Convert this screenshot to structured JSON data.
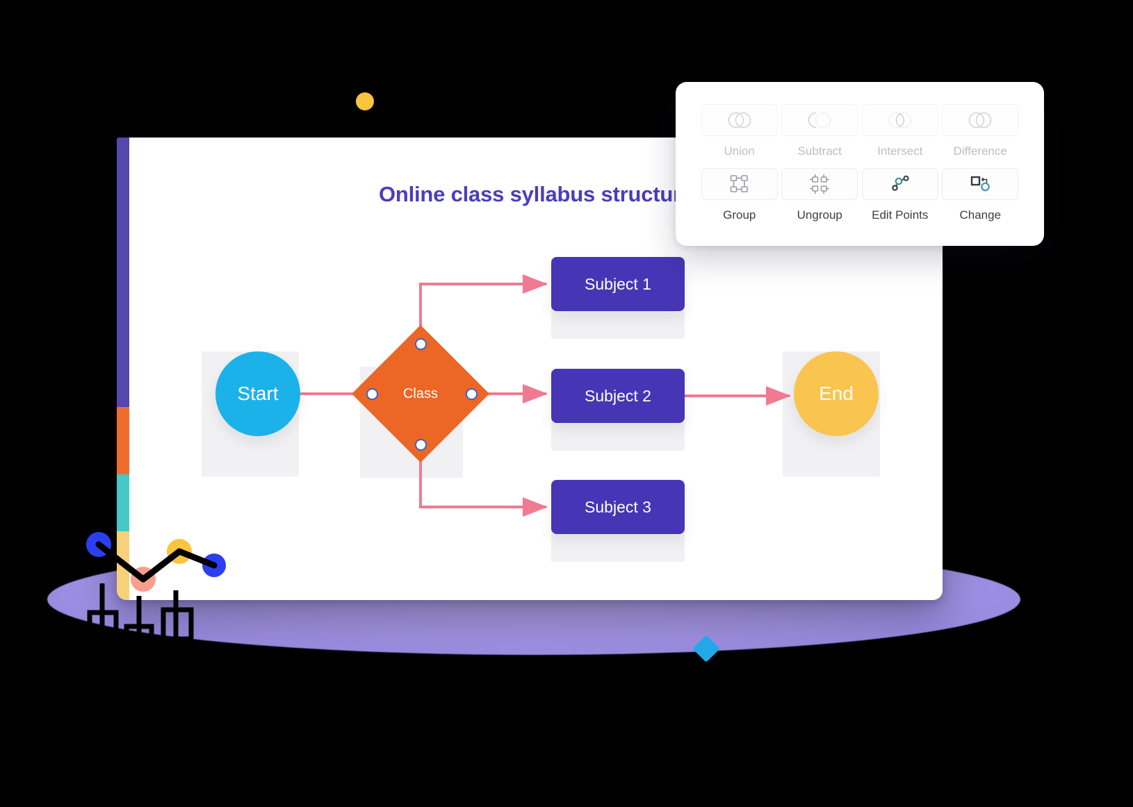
{
  "board": {
    "title": "Online class syllabus structure",
    "strip_colors": [
      "#5447ad",
      "#ef6d2c",
      "#45c8c6",
      "#f7d07a"
    ]
  },
  "diagram": {
    "type": "flowchart",
    "nodes": [
      {
        "id": "start",
        "label": "Start",
        "shape": "circle",
        "color": "#1bb2ea"
      },
      {
        "id": "class",
        "label": "Class",
        "shape": "diamond",
        "color": "#ec6626",
        "selected": true
      },
      {
        "id": "subject1",
        "label": "Subject 1",
        "shape": "rounded-rect",
        "color": "#4636b5"
      },
      {
        "id": "subject2",
        "label": "Subject 2",
        "shape": "rounded-rect",
        "color": "#4636b5"
      },
      {
        "id": "subject3",
        "label": "Subject 3",
        "shape": "rounded-rect",
        "color": "#4636b5"
      },
      {
        "id": "end",
        "label": "End",
        "shape": "circle",
        "color": "#f9c550"
      }
    ],
    "edges": [
      {
        "from": "start",
        "to": "class",
        "style": "straight"
      },
      {
        "from": "class",
        "to": "subject1",
        "style": "elbow-up"
      },
      {
        "from": "class",
        "to": "subject2",
        "style": "straight"
      },
      {
        "from": "class",
        "to": "subject3",
        "style": "elbow-down"
      },
      {
        "from": "subject2",
        "to": "end",
        "style": "straight"
      }
    ],
    "edge_color": "#ef7a92",
    "selection_handle_color": "#3b63c7"
  },
  "panel": {
    "rows": [
      {
        "tools": [
          {
            "name": "union",
            "label": "Union",
            "icon": "union-icon",
            "enabled": false
          },
          {
            "name": "subtract",
            "label": "Subtract",
            "icon": "subtract-icon",
            "enabled": false
          },
          {
            "name": "intersect",
            "label": "Intersect",
            "icon": "intersect-icon",
            "enabled": false
          },
          {
            "name": "difference",
            "label": "Difference",
            "icon": "difference-icon",
            "enabled": false
          }
        ]
      },
      {
        "tools": [
          {
            "name": "group",
            "label": "Group",
            "icon": "group-icon",
            "enabled": true
          },
          {
            "name": "ungroup",
            "label": "Ungroup",
            "icon": "ungroup-icon",
            "enabled": true
          },
          {
            "name": "edit-points",
            "label": "Edit Points",
            "icon": "edit-points-icon",
            "enabled": true
          },
          {
            "name": "change",
            "label": "Change",
            "icon": "change-shape-icon",
            "enabled": true
          }
        ]
      }
    ]
  },
  "decorations": {
    "yellow_dot": "#f9c43f",
    "blue_diamond": "#22a8e8",
    "purple_ellipse": "#a99af0",
    "chart_dots": [
      "#2a3ff0",
      "#f79e8e",
      "#f9c43f",
      "#2a3ff0"
    ]
  }
}
